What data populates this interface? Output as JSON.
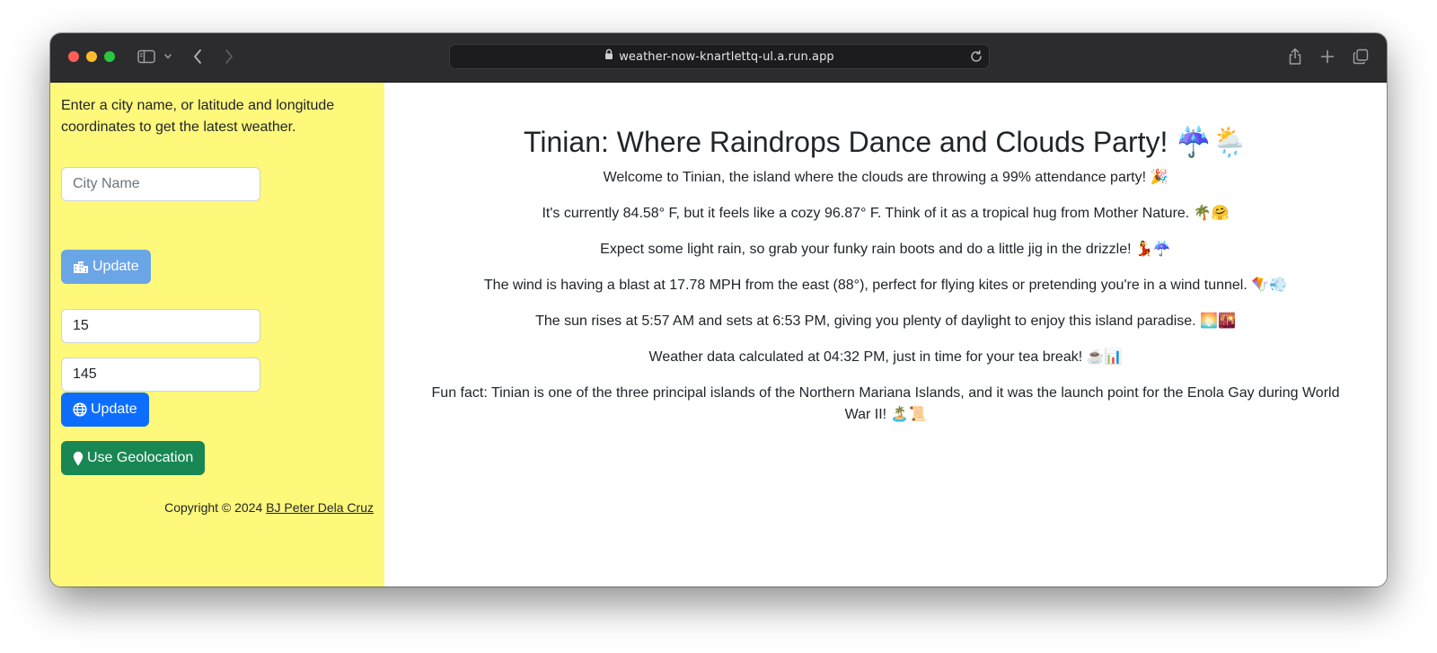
{
  "browser": {
    "url": "weather-now-knartlettq-ul.a.run.app"
  },
  "icons": {
    "window_controls": [
      "close-light",
      "minimize-light",
      "zoom-light"
    ],
    "toolbar": [
      "sidebar-icon",
      "chevron-down-icon",
      "back-icon",
      "forward-icon",
      "lock-icon",
      "reload-icon",
      "share-icon",
      "plus-icon",
      "tabs-icon"
    ],
    "buttons": [
      "city-icon",
      "globe-icon",
      "map-pin-icon"
    ]
  },
  "sidebar": {
    "intro": "Enter a city name, or latitude and longitude coordinates to get the latest weather.",
    "city_placeholder": "City Name",
    "city_button": "Update",
    "latitude": "15",
    "longitude": "145",
    "coords_button": "Update",
    "geo_button": "Use Geolocation",
    "copyright_prefix": "Copyright © 2024",
    "author": "BJ Peter Dela Cruz"
  },
  "main": {
    "title": "Tinian: Where Raindrops Dance and Clouds Party! ☔️🌦️",
    "paragraphs": [
      "Welcome to Tinian, the island where the clouds are throwing a 99% attendance party! 🎉",
      "It's currently 84.58° F, but it feels like a cozy 96.87° F. Think of it as a tropical hug from Mother Nature. 🌴🤗",
      "Expect some light rain, so grab your funky rain boots and do a little jig in the drizzle! 💃☔️",
      "The wind is having a blast at 17.78 MPH from the east (88°), perfect for flying kites or pretending you're in a wind tunnel. 🪁💨",
      "The sun rises at 5:57 AM and sets at 6:53 PM, giving you plenty of daylight to enjoy this island paradise. 🌅🌇",
      "Weather data calculated at 04:32 PM, just in time for your tea break! ☕️📊",
      "Fun fact: Tinian is one of the three principal islands of the Northern Mariana Islands, and it was the launch point for the Enola Gay during World War II! 🏝️📜"
    ]
  },
  "colors": {
    "sidebar_bg": "#fef87b",
    "primary": "#0d6efd",
    "primary_light": "#6aa5e6",
    "success": "#198754",
    "toolbar_bg": "#2c2c2e"
  }
}
